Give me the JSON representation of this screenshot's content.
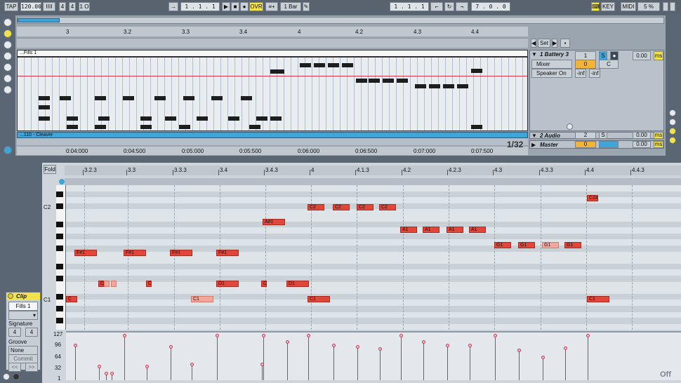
{
  "transport": {
    "tap": "TAP",
    "tempo": "120.00",
    "meter_bars": "IIII",
    "sig_num": "4",
    "sig_den": "4",
    "metronome": "1 O",
    "position": "1 . 1 . 1",
    "ovr": "OVR",
    "quantize": "1 Bar",
    "loop_start": "1 . 1 . 1",
    "loop_len": "7 . 0 . 0",
    "key": "KEY",
    "midi": "MIDI",
    "cpu": "5 %"
  },
  "arrangement": {
    "bar_ruler": [
      "3",
      "3.2",
      "3.3",
      "3.4",
      "4",
      "4.2",
      "4.3",
      "4.4"
    ],
    "time_ruler": [
      "0:04:000",
      "0:04:500",
      "0:05:000",
      "0:05:500",
      "0:06:000",
      "0:06:500",
      "0:07:000",
      "0:07:500"
    ],
    "clip_top": "...Fills 1",
    "clip_bottom": "...110 - Cleaver",
    "grid": "1/32",
    "set_label": "Set",
    "track1": {
      "name": "1 Battery 3",
      "routing_a": "Mixer",
      "routing_b": "Speaker On",
      "number": "1",
      "solo": "S",
      "pan": "0",
      "key": "C",
      "peak_l": "-inf",
      "peak_r": "-inf",
      "delay": "0.00",
      "delay_unit": "ms"
    },
    "track2": {
      "name": "2 Audio",
      "number": "2",
      "solo": "S",
      "delay": "0.00",
      "delay_unit": "ms"
    },
    "master": {
      "name": "Master",
      "pan": "0",
      "delay": "0.00",
      "delay_unit": "ms"
    }
  },
  "clip_panel": {
    "title": "Clip",
    "name": "Fills 1",
    "signature_label": "Signature",
    "sig_num": "4",
    "sig_den": "4",
    "groove_label": "Groove",
    "groove_value": "None",
    "commit": "Commit",
    "nav_prev": "<<",
    "nav_next": ">>"
  },
  "piano_roll": {
    "fold": "Fold",
    "ruler": [
      "3.2.3",
      "3.3",
      "3.3.3",
      "3.4",
      "3.4.3",
      "4",
      "4.1.3",
      "4.2",
      "4.2.3",
      "4.3",
      "4.3.3",
      "4.4",
      "4.4.3"
    ],
    "key_labels": [
      "C2",
      "C1"
    ],
    "velocity_scale": [
      "127",
      "96",
      "64",
      "32",
      "1"
    ],
    "off_label": "Off",
    "notes": [
      {
        "label": "C2#2"
      },
      {
        "label": "C2"
      },
      {
        "label": "C2"
      },
      {
        "label": "C2"
      },
      {
        "label": "C2"
      },
      {
        "label": "A#1"
      },
      {
        "label": "A1"
      },
      {
        "label": "A1"
      },
      {
        "label": "A1"
      },
      {
        "label": "A1"
      },
      {
        "label": "G1"
      },
      {
        "label": "G1"
      },
      {
        "label": "G1"
      },
      {
        "label": "G1"
      },
      {
        "label": "F#1"
      },
      {
        "label": "F#1"
      },
      {
        "label": "F#1"
      },
      {
        "label": "F#1"
      },
      {
        "label": "D"
      },
      {
        "label": "D"
      },
      {
        "label": "D1"
      },
      {
        "label": "D"
      },
      {
        "label": "D1"
      },
      {
        "label": "C"
      },
      {
        "label": "C1"
      },
      {
        "label": "C1"
      },
      {
        "label": "C1"
      }
    ],
    "velocities": [
      100,
      40,
      20,
      20,
      127,
      40,
      96,
      45,
      127,
      45,
      127,
      110,
      127,
      100,
      96,
      90,
      127,
      110,
      100,
      100,
      127,
      85,
      65,
      92,
      127
    ]
  },
  "colors": {
    "note": "#e0473a",
    "accent_yellow": "#f3e34a",
    "accent_blue": "#3fa4d8",
    "playhead": "#d8324a"
  }
}
